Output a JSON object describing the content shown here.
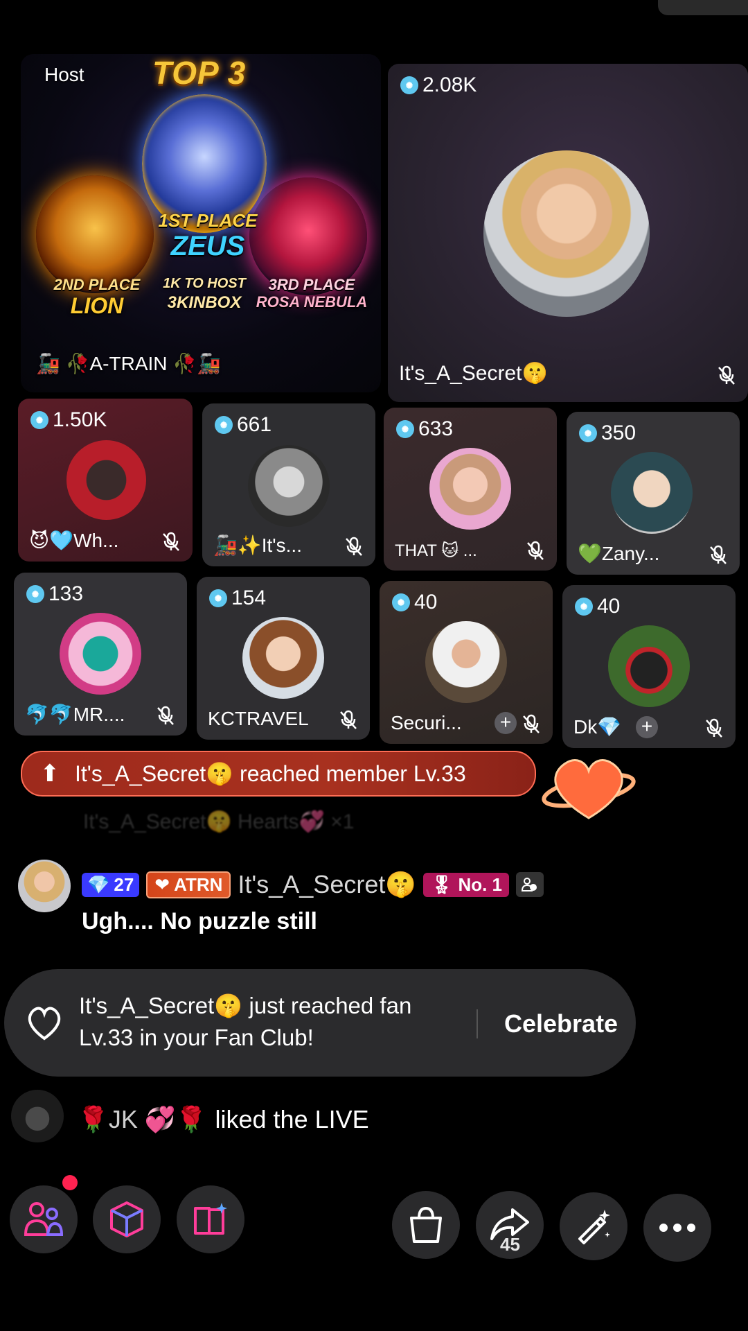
{
  "host": {
    "label": "Host",
    "top_title": "TOP 3",
    "first_place": "1ST PLACE",
    "first_name": "ZEUS",
    "second_place": "2ND PLACE",
    "second_name": "LION",
    "middle_line1": "1K TO HOST",
    "middle_line2": "3KINBOX",
    "third_place": "3RD PLACE",
    "third_name": "ROSA NEBULA",
    "name": "🚂 🥀A-TRAIN 🥀🚂"
  },
  "guest_main": {
    "score": "2.08K",
    "name": "It's_A_Secret🤫"
  },
  "guests": [
    {
      "score": "1.50K",
      "name": "😈🩵Wh..."
    },
    {
      "score": "661",
      "name": "🚂✨It's..."
    },
    {
      "score": "633",
      "name": "THAT 🐱 ..."
    },
    {
      "score": "350",
      "name": "💚Zany..."
    },
    {
      "score": "133",
      "name": "🐬🐬MR...."
    },
    {
      "score": "154",
      "name": "KCTRAVEL"
    },
    {
      "score": "40",
      "name": "Securi..."
    },
    {
      "score": "40",
      "name": "Dk💎"
    }
  ],
  "banner": {
    "text": "It's_A_Secret🤫 reached member Lv.33"
  },
  "ghost_line": "It's_A_Secret🤫 Hearts💞 ×1",
  "chat": {
    "level_badge": "27",
    "fan_badge": "ATRN",
    "name": "It's_A_Secret🤫",
    "rank_badge": "No. 1",
    "message": "Ugh.... No puzzle still"
  },
  "fanclub": {
    "text": "It's_A_Secret🤫 just reached fan Lv.33 in your Fan Club!",
    "action": "Celebrate"
  },
  "like": {
    "name": "🌹JK 💞🌹",
    "text": "liked the LIVE"
  },
  "bottom_bar": {
    "share_count": "45",
    "icons": [
      "people-icon",
      "box-icon",
      "book-icon",
      "bag-icon",
      "share-icon",
      "magic-wand-icon",
      "more-icon"
    ]
  },
  "colors": {
    "accent_pink": "#ff2f92",
    "banner_red": "#a8311f",
    "gem_blue": "#5fc8f0",
    "rank_badge": "#b0155a",
    "level_badge": "#3a3aff"
  }
}
